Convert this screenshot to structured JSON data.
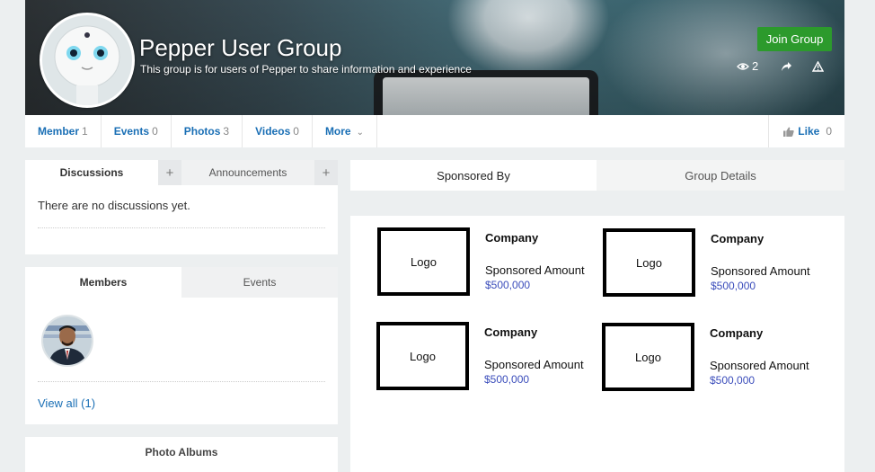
{
  "group": {
    "title": "Pepper User Group",
    "description": "This group is for users of Pepper to share information and experience",
    "join_label": "Join Group",
    "views": "2"
  },
  "nav": {
    "items": [
      {
        "label": "Member",
        "count": "1"
      },
      {
        "label": "Events",
        "count": "0"
      },
      {
        "label": "Photos",
        "count": "3"
      },
      {
        "label": "Videos",
        "count": "0"
      }
    ],
    "more_label": "More",
    "like_label": "Like",
    "like_count": "0"
  },
  "discussions": {
    "tab_discussions": "Discussions",
    "tab_announcements": "Announcements",
    "plus": "+",
    "empty": "There are no discussions yet."
  },
  "members": {
    "tab_members": "Members",
    "tab_events": "Events",
    "view_all": "View all (1)"
  },
  "albums": {
    "title": "Photo Albums"
  },
  "right": {
    "tab_sponsored": "Sponsored By",
    "tab_details": "Group Details"
  },
  "sponsors": [
    {
      "logo": "Logo",
      "company": "Company",
      "amount_label": "Sponsored Amount",
      "amount": "$500,000"
    },
    {
      "logo": "Logo",
      "company": "Company",
      "amount_label": "Sponsored Amount",
      "amount": "$500,000"
    },
    {
      "logo": "Logo",
      "company": "Company",
      "amount_label": "Sponsored Amount",
      "amount": "$500,000"
    },
    {
      "logo": "Logo",
      "company": "Company",
      "amount_label": "Sponsored Amount",
      "amount": "$500,000"
    }
  ],
  "colors": {
    "accent_link": "#1a6fb5",
    "join_green": "#2c9a2c",
    "amount_blue": "#3b4dbb"
  },
  "icons": [
    "eye-icon",
    "share-icon",
    "warning-icon",
    "thumbs-up-icon",
    "chevron-down-icon",
    "plus-icon"
  ]
}
